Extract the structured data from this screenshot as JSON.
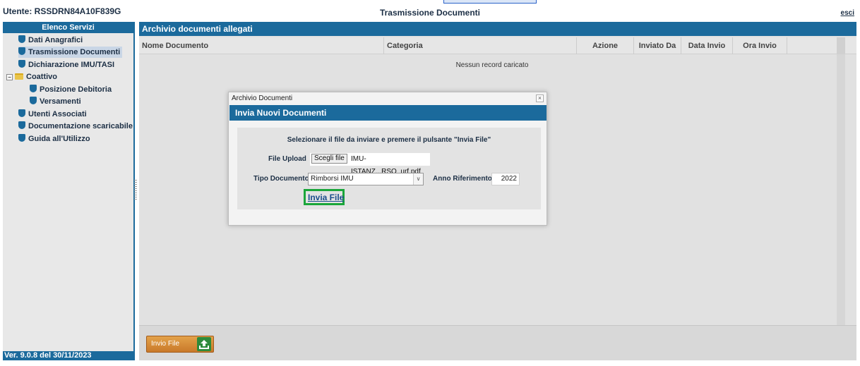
{
  "header": {
    "user": "Utente: RSSDRN84A10F839G",
    "title": "Trasmissione Documenti",
    "logout": "esci"
  },
  "sidebar": {
    "title": "Elenco Servizi",
    "items": [
      {
        "label": "Dati Anagrafici",
        "icon": "shield-icon"
      },
      {
        "label": "Trasmissione Documenti",
        "icon": "shield-icon",
        "active": true
      },
      {
        "label": "Dichiarazione IMU/TASI",
        "icon": "shield-icon"
      },
      {
        "label": "Coattivo",
        "icon": "folder-icon",
        "expanded": true
      },
      {
        "label": "Posizione Debitoria",
        "icon": "shield-icon"
      },
      {
        "label": "Versamenti",
        "icon": "shield-icon"
      },
      {
        "label": "Utenti Associati",
        "icon": "shield-icon"
      },
      {
        "label": "Documentazione scaricabile",
        "icon": "shield-icon"
      },
      {
        "label": "Guida all'Utilizzo",
        "icon": "shield-icon"
      }
    ],
    "version": "Ver. 9.0.8 del 30/11/2023"
  },
  "main": {
    "title": "Archivio documenti allegati",
    "columns": [
      "Nome Documento",
      "Categoria",
      "Azione",
      "Inviato Da",
      "Data Invio",
      "Ora Invio"
    ],
    "empty_message": "Nessun record caricato",
    "footer_button": "Invio File"
  },
  "modal": {
    "title": "Archivio Documenti",
    "close": "×",
    "header": "Invia Nuovi Documenti",
    "instruction": "Selezionare il file da inviare e premere il pulsante \"Invia File\"",
    "file_label": "File Upload",
    "choose_button": "Scegli file",
    "file_name": "IMU-ISTANZ...RSO_urf.pdf",
    "type_label": "Tipo Documento",
    "type_value": "Rimborsi IMU",
    "year_label": "Anno Riferimento",
    "year_value": "2022",
    "submit": "Invia File"
  },
  "colors": {
    "accent": "#1b6a9c",
    "highlight_border": "#1aa63a",
    "footer_button": "#c9792a"
  }
}
